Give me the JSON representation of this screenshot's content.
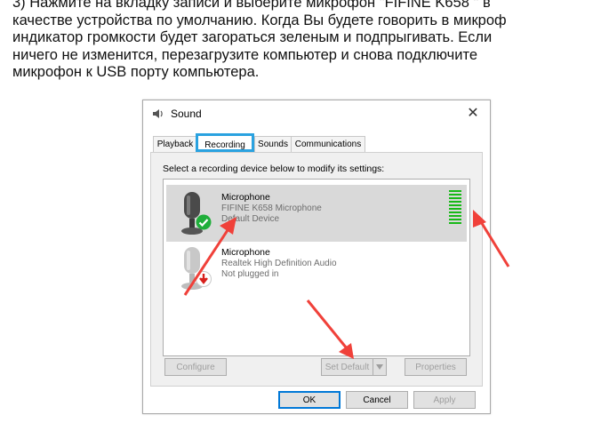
{
  "instructions": {
    "line1": "3) Нажмите на вкладку записи и выберите микрофон \"FIFINE K658 \" в",
    "line2": "качестве устройства по умолчанию. Когда Вы будете говорить в микроф",
    "line3": "индикатор громкости будет загораться зеленым и подпрыгивать. Если",
    "line4": "ничего не изменится, перезагрузите компьютер и снова подключите",
    "line5": "микрофон к USB порту компьютера."
  },
  "dialog": {
    "title": "Sound",
    "close_symbol": "✕",
    "tabs": [
      {
        "label": "Playback"
      },
      {
        "label": "Recording"
      },
      {
        "label": "Sounds"
      },
      {
        "label": "Communications"
      }
    ],
    "active_tab": "Recording",
    "prompt": "Select a recording device below to modify its settings:",
    "devices": [
      {
        "name": "Microphone",
        "description": "FIFINE K658 Microphone",
        "status": "Default Device",
        "status_icon": "green-check-icon",
        "selected": true,
        "level_bars": 10
      },
      {
        "name": "Microphone",
        "description": "Realtek High Definition Audio",
        "status": "Not plugged in",
        "status_icon": "red-down-arrow-icon",
        "selected": false
      }
    ],
    "buttons": {
      "configure": "Configure",
      "set_default": "Set Default",
      "properties": "Properties",
      "ok": "OK",
      "cancel": "Cancel",
      "apply": "Apply"
    }
  },
  "colors": {
    "accent_tab_highlight": "#2aa2e0",
    "annotation_arrow": "#f0413a",
    "level_meter": "#18b918",
    "default_check": "#1fae3a",
    "unplugged": "#d8201c"
  }
}
